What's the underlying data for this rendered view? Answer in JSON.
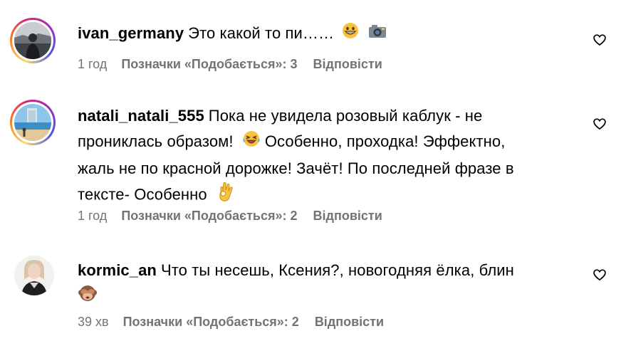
{
  "comments": [
    {
      "username": "ivan_germany",
      "text": "Это какой то пи……",
      "emojis": [
        "grinning-face-emoji",
        "camera-emoji"
      ],
      "time": "1 год",
      "likes": "Позначки «Подобається»: 3",
      "reply": "Відповісти",
      "story_ring": true
    },
    {
      "username": "natali_natali_555",
      "text": "Пока не увидела розовый каблук - не проникласьобразом!",
      "text_line1": "Пока не увидела розовый каблук - не",
      "text_line2": "прониклась образом!",
      "text_line2b": "Особенно, проходка! Эффектно,",
      "text_line3": "жаль не по красной дорожке! Зачёт! По последней фразе в",
      "text_line4": "тексте- Особенно",
      "emojis": [
        "laughing-tears-emoji",
        "ok-hand-emoji"
      ],
      "time": "1 год",
      "likes": "Позначки «Подобається»: 2",
      "reply": "Відповісти",
      "story_ring": true
    },
    {
      "username": "kormic_an",
      "text": "Что ты несешь, Ксения?, новогодняя ёлка, блин",
      "emojis": [
        "see-no-evil-monkey-emoji"
      ],
      "time": "39 хв",
      "likes": "Позначки «Подобається»: 2",
      "reply": "Відповісти",
      "story_ring": false
    }
  ],
  "colors": {
    "meta_text": "#737373",
    "primary_text": "#000000",
    "ring_gradient": [
      "#feda75",
      "#fa7e1e",
      "#d62976",
      "#962fbf",
      "#4f5bd5"
    ]
  }
}
